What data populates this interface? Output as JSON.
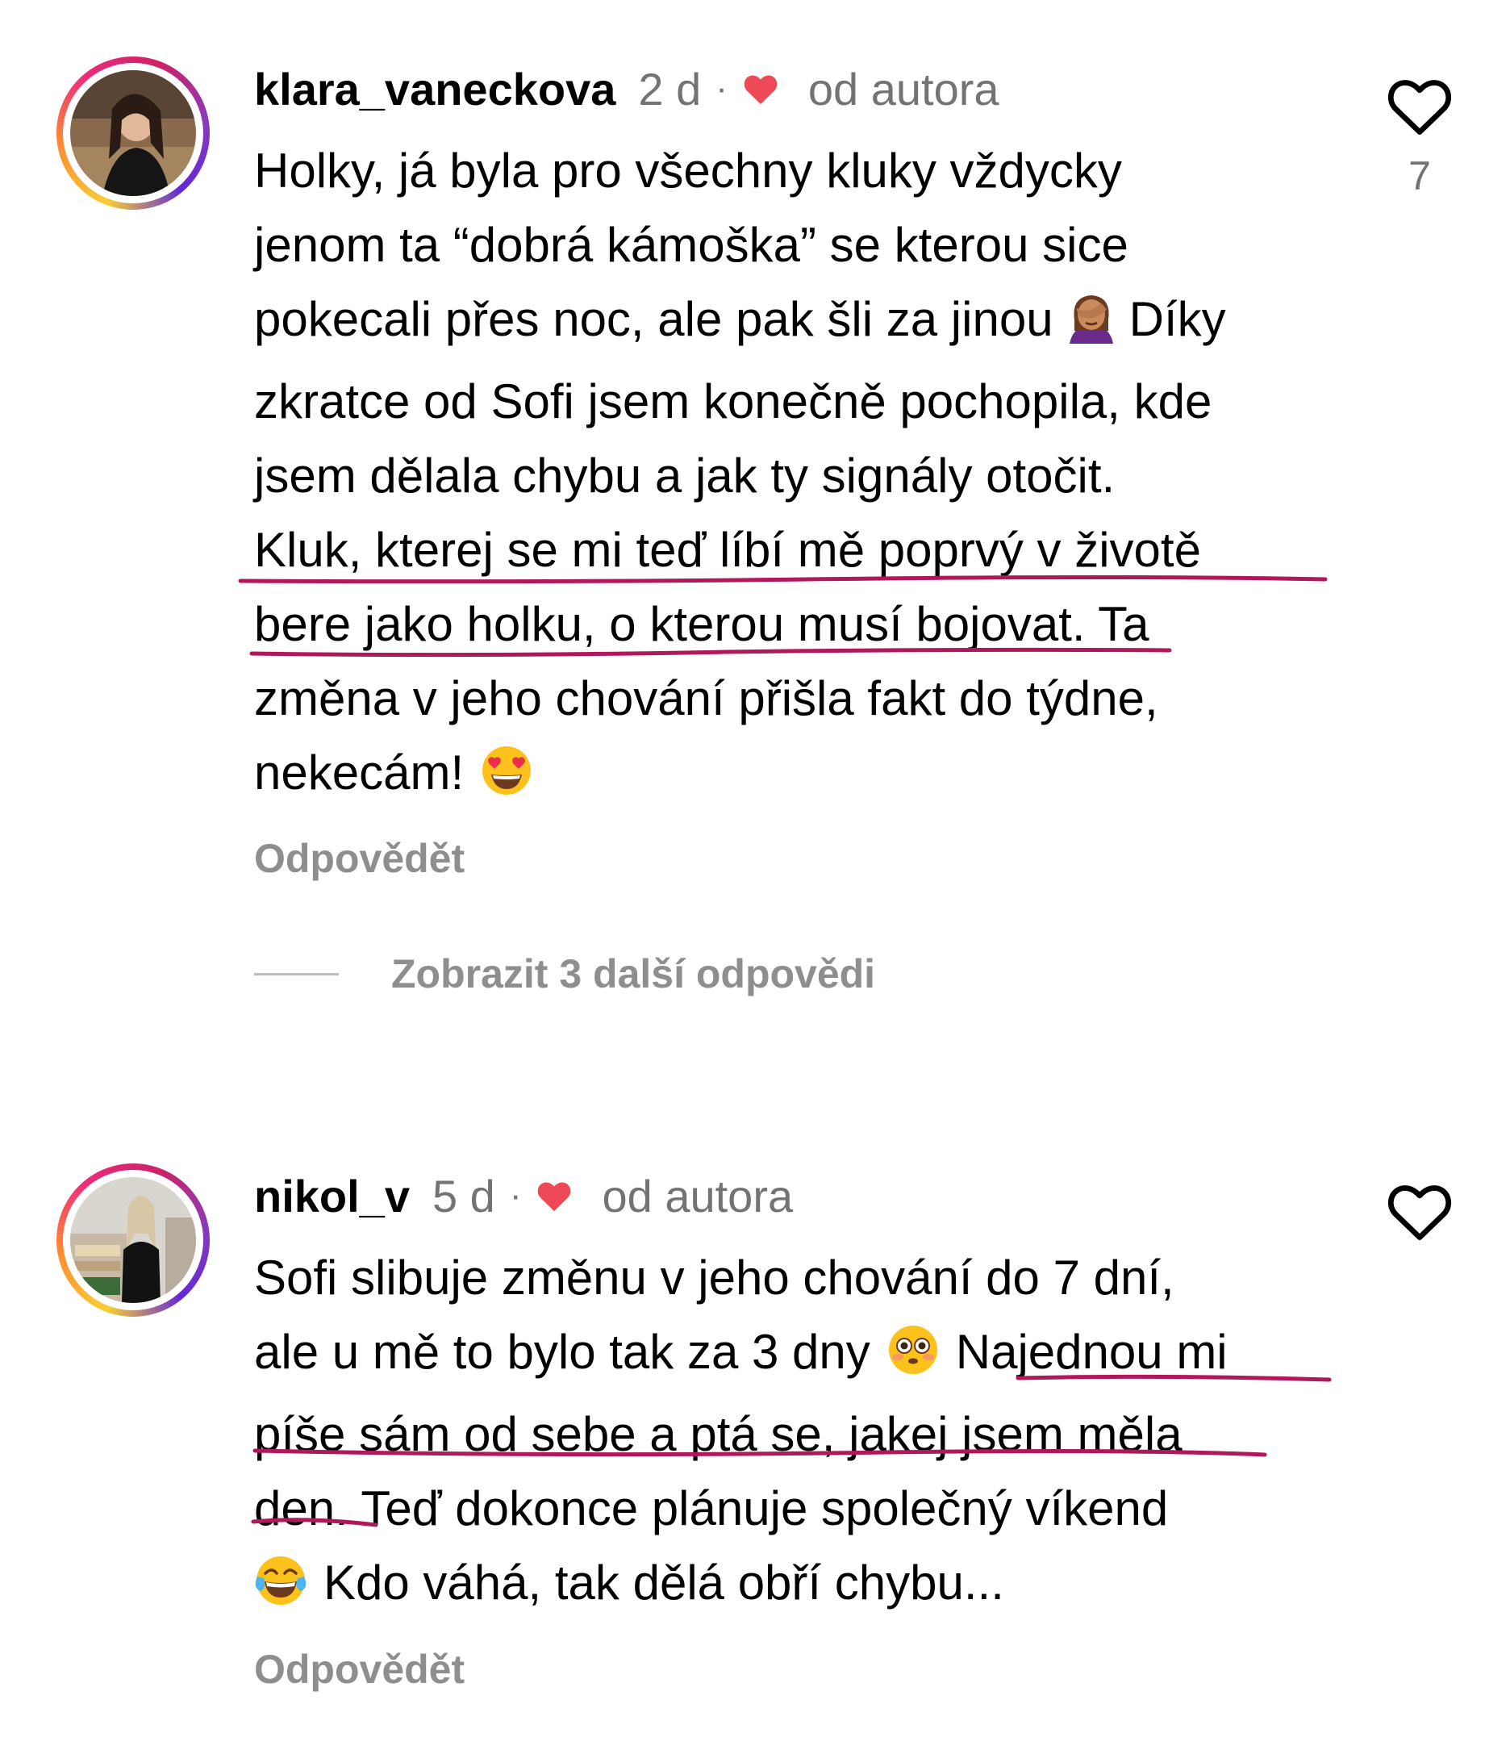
{
  "comments": [
    {
      "username": "klara_vaneckova",
      "time": "2 d",
      "separator": "·",
      "liked_by_author_label": "od autora",
      "text_lines": [
        "Holky, já byla pro všechny kluky vždycky",
        "jenom ta “dobrá kámoška” se kterou sice",
        "pokecali přes noc, ale pak šli za jinou",
        "Díky",
        "zkratce od Sofi jsem konečně pochopila, kde",
        "jsem dělala chybu a jak ty signály otočit.",
        "Kluk, kterej se mi teď líbí mě poprvý v životě",
        "bere jako holku, o kterou musí bojovat. Ta",
        "změna v jeho chování přišla fakt do týdne,",
        "nekecám!"
      ],
      "emojis": [
        "face-palm-emoji",
        "heart-eyes-emoji"
      ],
      "like_count": "7",
      "reply_label": "Odpovědět",
      "more_replies_label": "Zobrazit 3 další odpovědi"
    },
    {
      "username": "nikol_v",
      "time": "5 d",
      "separator": "·",
      "liked_by_author_label": "od autora",
      "text_lines": [
        "Sofi slibuje změnu v jeho chování do 7 dní,",
        "ale u mě to bylo tak za 3 dny",
        "Najednou mi",
        "píše sám od sebe a ptá se, jakej jsem měla",
        "den. Teď dokonce plánuje společný víkend",
        "Kdo váhá, tak dělá obří chybu..."
      ],
      "emojis": [
        "flushed-face-emoji",
        "tears-of-joy-emoji"
      ],
      "reply_label": "Odpovědět"
    }
  ],
  "colors": {
    "text": "#000000",
    "secondary_text": "#737373",
    "heart_red": "#ed4956",
    "underline_annotation": "#b0185a"
  }
}
